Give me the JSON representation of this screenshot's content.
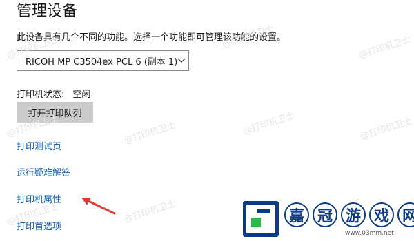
{
  "page": {
    "title": "管理设备",
    "description": "此设备具有几个不同的功能。选择一个功能即可管理该功能的设置。"
  },
  "printer_select": {
    "value": "RICOH MP C3504ex PCL 6 (副本 1)",
    "icon": "chevron-down-icon"
  },
  "status": {
    "label": "打印机状态:",
    "value": "空闲"
  },
  "buttons": {
    "open_queue": "打开打印队列"
  },
  "links": [
    "打印测试页",
    "运行疑难解答",
    "打印机属性",
    "打印首选项"
  ],
  "watermark": {
    "text": "@打印机卫士"
  },
  "site_logo": {
    "chars": [
      "嘉",
      "冠",
      "游",
      "戏",
      "网"
    ],
    "url": "www.03mm.net"
  },
  "colors": {
    "link": "#0a5fb8",
    "button_bg": "#cccccc",
    "arrow": "#e53935",
    "logo_blue": "#0d3a84",
    "logo_green": "#2fb84a"
  }
}
